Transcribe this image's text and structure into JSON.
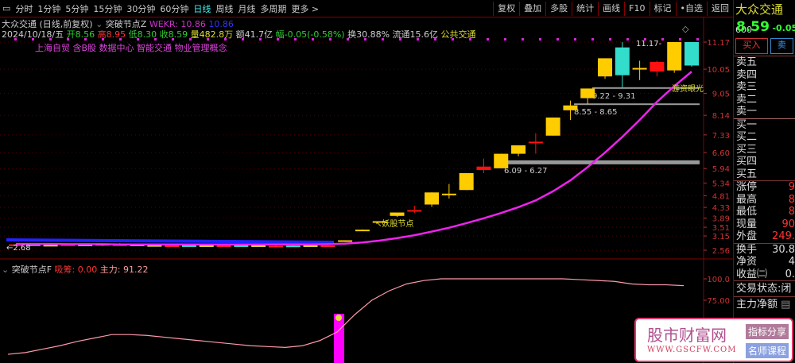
{
  "toolbar": {
    "periods": [
      "分时",
      "1分钟",
      "5分钟",
      "15分钟",
      "30分钟",
      "60分钟",
      "日线",
      "周线",
      "月线",
      "多周期",
      "更多 >"
    ],
    "active": "日线",
    "tools": [
      "复权",
      "叠加",
      "多股",
      "统计",
      "画线",
      "F10",
      "标记",
      "•自选",
      "返回"
    ]
  },
  "info": {
    "title": "大众交通 (日线,前复权)",
    "indicator": "突破节点Z",
    "wekr_label": "WEKR: 10.86",
    "wekr2": "10.86",
    "date": "2024/10/18/五",
    "open": "开8.56",
    "high": "高8.95",
    "low": "低8.30",
    "close": "收8.59",
    "volume": "量482.8万",
    "amount": "额41.7亿",
    "change": "幅-0.05(-0.58%)",
    "turnover": "换30.88%",
    "float": "流通15.6亿",
    "sector": "公共交通",
    "concepts": "上海自贸 含B股 数据中心 智能交通 物业管理概念"
  },
  "price_axis": [
    "11.17",
    "10.05",
    "9.05",
    "8.14",
    "7.33",
    "6.60",
    "5.94",
    "5.34",
    "4.81",
    "4.33",
    "3.89",
    "3.51",
    "3.15",
    "2.56"
  ],
  "annotations": {
    "high_label": "11.17",
    "low_label": "2.68",
    "zones": [
      "9.22 - 9.31",
      "8.55 - 8.65",
      "6.09 - 6.27"
    ],
    "tag": "游资眼光",
    "node": "妖股节点"
  },
  "candles": [
    [
      2.78,
      2.82,
      2.75,
      2.8
    ],
    [
      2.8,
      2.82,
      2.76,
      2.78
    ],
    [
      2.78,
      2.8,
      2.75,
      2.77
    ],
    [
      2.8,
      2.83,
      2.77,
      2.75
    ],
    [
      2.77,
      2.85,
      2.75,
      2.79
    ],
    [
      2.76,
      2.8,
      2.74,
      2.82
    ],
    [
      2.8,
      2.86,
      2.78,
      2.76
    ],
    [
      2.77,
      2.79,
      2.74,
      2.79
    ],
    [
      2.76,
      2.78,
      2.74,
      2.77
    ],
    [
      2.76,
      2.77,
      2.74,
      2.75
    ],
    [
      2.75,
      2.77,
      2.73,
      2.76
    ],
    [
      2.75,
      2.77,
      2.73,
      2.76
    ],
    [
      2.75,
      2.77,
      2.73,
      2.76
    ],
    [
      2.76,
      2.78,
      2.74,
      2.74
    ],
    [
      2.75,
      2.77,
      2.73,
      2.76
    ],
    [
      2.74,
      2.76,
      2.72,
      2.73
    ],
    [
      2.74,
      2.76,
      2.72,
      2.75
    ],
    [
      2.76,
      2.8,
      2.74,
      2.73
    ],
    [
      2.76,
      2.86,
      2.72,
      2.72
    ],
    [
      2.96,
      2.97,
      2.9,
      2.97
    ],
    [
      3.4,
      3.42,
      3.38,
      3.41
    ],
    [
      3.74,
      3.76,
      3.7,
      3.76
    ],
    [
      3.98,
      4.02,
      3.94,
      4.12
    ],
    [
      4.22,
      4.4,
      4.1,
      4.2
    ],
    [
      4.45,
      4.95,
      4.35,
      4.95
    ],
    [
      4.9,
      5.3,
      4.7,
      4.9
    ],
    [
      5.05,
      5.75,
      5.05,
      5.75
    ],
    [
      6.02,
      6.35,
      5.75,
      5.88
    ],
    [
      5.95,
      6.55,
      5.95,
      6.55
    ],
    [
      6.55,
      6.9,
      6.45,
      6.9
    ],
    [
      7.05,
      7.4,
      6.55,
      7.0
    ],
    [
      7.3,
      8.05,
      7.3,
      8.05
    ],
    [
      8.35,
      8.75,
      7.95,
      8.55
    ],
    [
      8.85,
      9.25,
      8.6,
      9.25
    ],
    [
      9.75,
      10.5,
      9.65,
      10.5
    ],
    [
      9.8,
      11.17,
      9.3,
      10.95
    ],
    [
      10.1,
      10.4,
      9.6,
      10.1
    ],
    [
      10.35,
      10.4,
      9.75,
      9.95
    ],
    [
      10.0,
      11.17,
      9.9,
      11.17
    ],
    [
      10.2,
      11.17,
      10.15,
      11.17
    ]
  ],
  "ma": [
    2.82,
    2.82,
    2.82,
    2.81,
    2.81,
    2.81,
    2.8,
    2.8,
    2.8,
    2.8,
    2.8,
    2.8,
    2.8,
    2.8,
    2.8,
    2.8,
    2.8,
    2.8,
    2.81,
    2.83,
    2.88,
    2.96,
    3.06,
    3.18,
    3.33,
    3.49,
    3.68,
    3.88,
    4.1,
    4.34,
    4.62,
    5.0,
    5.45,
    6.0,
    6.6,
    7.25,
    7.95,
    8.7,
    9.35,
    9.95
  ],
  "indicator": {
    "name": "突破节点F",
    "xichou": "吸筹: 0.00",
    "zhuli": "主力: 91.22",
    "axis": [
      "100.0",
      "75.00"
    ],
    "line": [
      12,
      14,
      18,
      22,
      27,
      31,
      35,
      35,
      34,
      32,
      30,
      28,
      26,
      24,
      22,
      21,
      20,
      22,
      28,
      38,
      58,
      75,
      86,
      94,
      98,
      100,
      100,
      100,
      100,
      100,
      100,
      100,
      100,
      99,
      98,
      97,
      94,
      93,
      93,
      92
    ]
  },
  "side": {
    "name": "大众交通",
    "code": "600",
    "price": "8.59",
    "change": "-0.05",
    "buy": "买入",
    "sell": "卖",
    "asks": [
      "卖五",
      "卖四",
      "卖三",
      "卖二",
      "卖一"
    ],
    "bids": [
      "买一",
      "买二",
      "买三",
      "买四",
      "买五"
    ],
    "stats": [
      [
        "涨停",
        "9"
      ],
      [
        "最高",
        "8"
      ],
      [
        "最低",
        "8"
      ],
      [
        "现量",
        "90"
      ],
      [
        "外盘",
        "249."
      ]
    ],
    "stats2": [
      [
        "换手",
        "30.8"
      ],
      [
        "净资",
        "4"
      ],
      [
        "收益㈡",
        "0."
      ]
    ],
    "status": "交易状态:闭",
    "netflow": "主力净额"
  },
  "watermark": {
    "name": "股市财富网",
    "url": "WWW.GSCFW.COM",
    "tag1": "指标分享",
    "tag2": "名师课程"
  }
}
